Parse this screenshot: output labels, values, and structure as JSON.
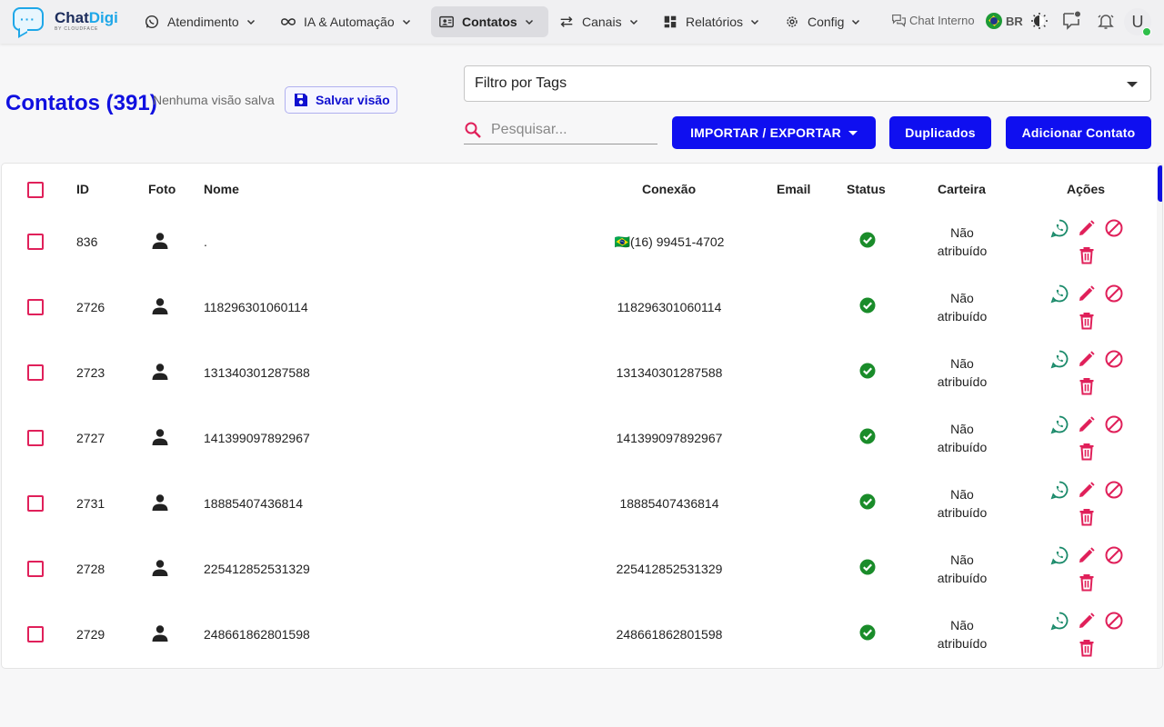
{
  "brand": {
    "name_a": "Chat",
    "name_b": "Digi",
    "sub": "BY CLOUDFACE"
  },
  "nav": {
    "items": [
      {
        "label": "Atendimento"
      },
      {
        "label": "IA & Automação"
      },
      {
        "label": "Contatos"
      },
      {
        "label": "Canais"
      },
      {
        "label": "Relatórios"
      },
      {
        "label": "Config"
      }
    ],
    "chat_interno": "Chat Interno",
    "lang": "BR",
    "avatar_letter": "U"
  },
  "header": {
    "title": "Contatos (391)",
    "no_view": "Nenhuma visão salva",
    "save_view": "Salvar visão",
    "tags_filter": "Filtro por Tags",
    "search_placeholder": "Pesquisar...",
    "import_export": "IMPORTAR / EXPORTAR",
    "duplicates": "Duplicados",
    "add_contact": "Adicionar Contato"
  },
  "table": {
    "columns": [
      "ID",
      "Foto",
      "Nome",
      "Conexão",
      "Email",
      "Status",
      "Carteira",
      "Ações"
    ],
    "rows": [
      {
        "id": "836",
        "name": ".",
        "connection": "🇧🇷(16) 99451-4702",
        "email": "",
        "wallet": [
          "Não",
          "atribuído"
        ]
      },
      {
        "id": "2726",
        "name": "118296301060114",
        "connection": "118296301060114",
        "email": "",
        "wallet": [
          "Não",
          "atribuído"
        ]
      },
      {
        "id": "2723",
        "name": "131340301287588",
        "connection": "131340301287588",
        "email": "",
        "wallet": [
          "Não",
          "atribuído"
        ]
      },
      {
        "id": "2727",
        "name": "141399097892967",
        "connection": "141399097892967",
        "email": "",
        "wallet": [
          "Não",
          "atribuído"
        ]
      },
      {
        "id": "2731",
        "name": "18885407436814",
        "connection": "18885407436814",
        "email": "",
        "wallet": [
          "Não",
          "atribuído"
        ]
      },
      {
        "id": "2728",
        "name": "225412852531329",
        "connection": "225412852531329",
        "email": "",
        "wallet": [
          "Não",
          "atribuído"
        ]
      },
      {
        "id": "2729",
        "name": "248661862801598",
        "connection": "248661862801598",
        "email": "",
        "wallet": [
          "Não",
          "atribuído"
        ]
      }
    ]
  },
  "colors": {
    "primary": "#0f0ff0",
    "accent": "#e0205a",
    "whatsapp": "#1a8a6a",
    "status_ok": "#1a8c2a"
  }
}
